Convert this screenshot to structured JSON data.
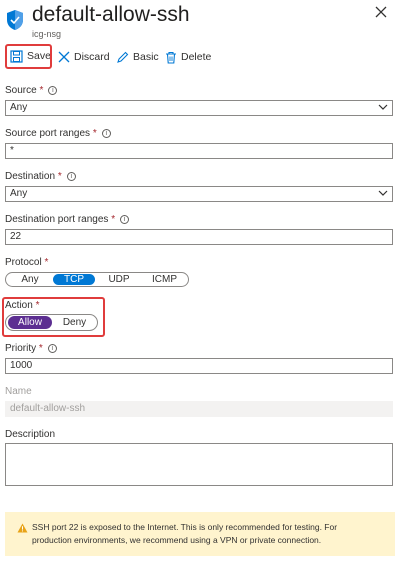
{
  "header": {
    "title": "default-allow-ssh",
    "subtitle": "icg-nsg"
  },
  "toolbar": {
    "save": "Save",
    "discard": "Discard",
    "basic": "Basic",
    "delete": "Delete"
  },
  "form": {
    "source": {
      "label": "Source",
      "required": "*",
      "value": "Any"
    },
    "source_port_ranges": {
      "label": "Source port ranges",
      "required": "*",
      "value": "*"
    },
    "destination": {
      "label": "Destination",
      "required": "*",
      "value": "Any"
    },
    "destination_port_ranges": {
      "label": "Destination port ranges",
      "required": "*",
      "value": "22"
    },
    "protocol": {
      "label": "Protocol",
      "required": "*",
      "options": [
        "Any",
        "TCP",
        "UDP",
        "ICMP"
      ],
      "selected": "TCP"
    },
    "action": {
      "label": "Action",
      "required": "*",
      "options": [
        "Allow",
        "Deny"
      ],
      "selected": "Allow"
    },
    "priority": {
      "label": "Priority",
      "required": "*",
      "value": "1000"
    },
    "name": {
      "label": "Name",
      "value": "default-allow-ssh"
    },
    "description": {
      "label": "Description",
      "value": ""
    }
  },
  "warning": {
    "text": "SSH port 22 is exposed to the Internet. This is only recommended for testing. For production environments, we recommend using a VPN or private connection."
  },
  "colors": {
    "accent": "#0078d4",
    "allow": "#5c2e91",
    "highlight": "#e03c3c",
    "warning_bg": "#fff4ce",
    "required": "#a4262c"
  },
  "icons": [
    "shield-icon",
    "close-icon",
    "save-icon",
    "discard-icon",
    "basic-icon",
    "delete-icon",
    "info-icon",
    "chevron-down-icon",
    "warning-icon"
  ]
}
